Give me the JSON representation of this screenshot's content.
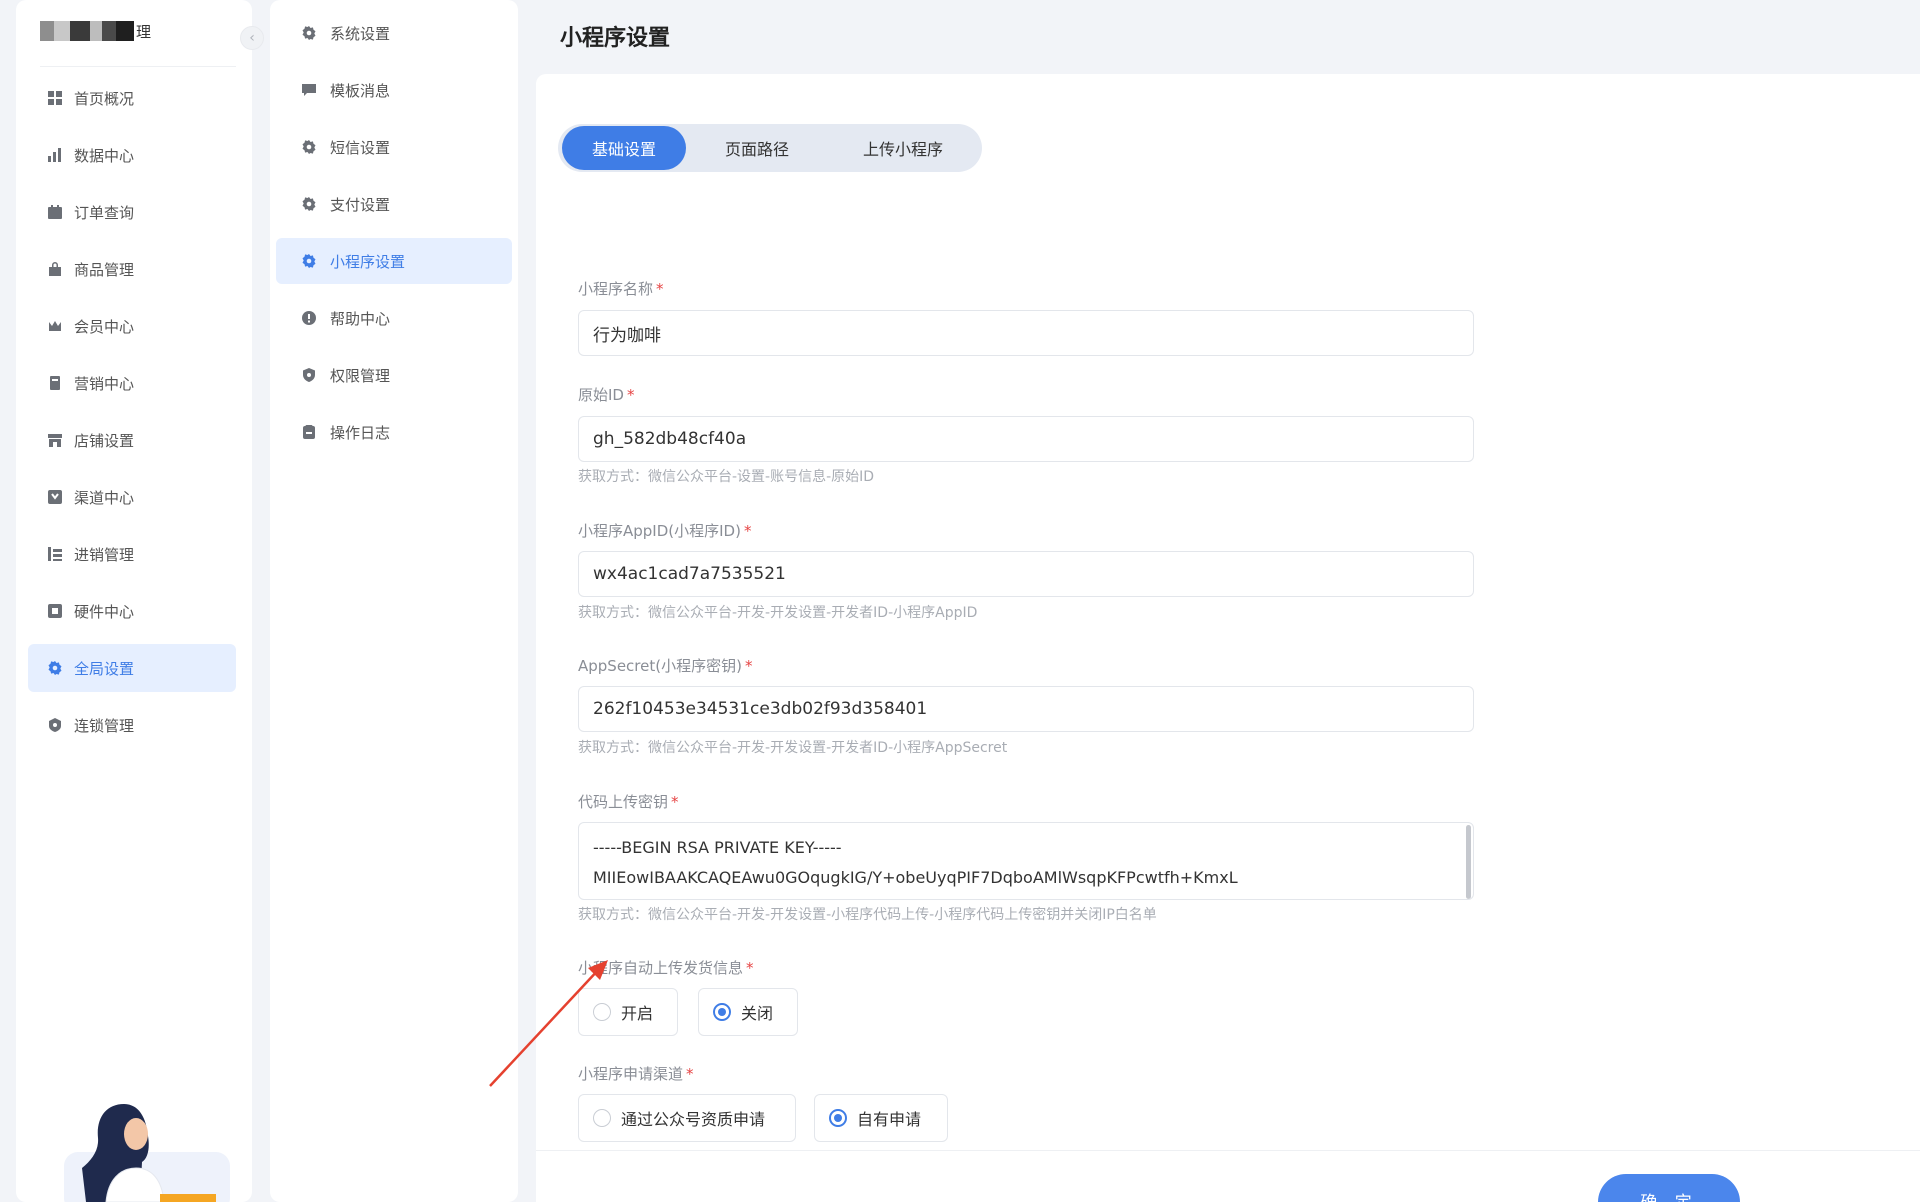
{
  "brand": {
    "text": "理",
    "colors": [
      "#8e8e8e",
      "#c8c8c8",
      "#3a3a3a",
      "#bdbdbd",
      "#4a4a4a",
      "#1f1f1f"
    ]
  },
  "sidebar": {
    "items": [
      {
        "label": "首页概况",
        "icon": "grid-icon",
        "active": false
      },
      {
        "label": "数据中心",
        "icon": "bar-chart-icon",
        "active": false
      },
      {
        "label": "订单查询",
        "icon": "calendar-icon",
        "active": false
      },
      {
        "label": "商品管理",
        "icon": "bag-icon",
        "active": false
      },
      {
        "label": "会员中心",
        "icon": "crown-icon",
        "active": false
      },
      {
        "label": "营销中心",
        "icon": "gift-icon",
        "active": false
      },
      {
        "label": "店铺设置",
        "icon": "store-icon",
        "active": false
      },
      {
        "label": "渠道中心",
        "icon": "channel-icon",
        "active": false
      },
      {
        "label": "进销管理",
        "icon": "inventory-icon",
        "active": false
      },
      {
        "label": "硬件中心",
        "icon": "hardware-icon",
        "active": false
      },
      {
        "label": "全局设置",
        "icon": "gear-icon",
        "active": true
      },
      {
        "label": "连锁管理",
        "icon": "chain-icon",
        "active": false
      }
    ]
  },
  "subnav": {
    "items": [
      {
        "label": "系统设置",
        "icon": "gear-icon",
        "active": false
      },
      {
        "label": "模板消息",
        "icon": "message-icon",
        "active": false
      },
      {
        "label": "短信设置",
        "icon": "gear-icon",
        "active": false
      },
      {
        "label": "支付设置",
        "icon": "gear-icon",
        "active": false
      },
      {
        "label": "小程序设置",
        "icon": "gear-icon",
        "active": true
      },
      {
        "label": "帮助中心",
        "icon": "help-icon",
        "active": false
      },
      {
        "label": "权限管理",
        "icon": "shield-icon",
        "active": false
      },
      {
        "label": "操作日志",
        "icon": "log-icon",
        "active": false
      }
    ]
  },
  "page": {
    "title": "小程序设置"
  },
  "tabs": [
    {
      "label": "基础设置",
      "active": true
    },
    {
      "label": "页面路径",
      "active": false
    },
    {
      "label": "上传小程序",
      "active": false
    }
  ],
  "form": {
    "required_mark": "*",
    "name": {
      "label": "小程序名称",
      "value": "行为咖啡"
    },
    "original_id": {
      "label": "原始ID",
      "value": "gh_582db48cf40a",
      "hint": "获取方式：微信公众平台-设置-账号信息-原始ID"
    },
    "app_id": {
      "label": "小程序AppID(小程序ID)",
      "value": "wx4ac1cad7a7535521",
      "hint": "获取方式：微信公众平台-开发-开发设置-开发者ID-小程序AppID"
    },
    "app_secret": {
      "label": "AppSecret(小程序密钥)",
      "value": "262f10453e34531ce3db02f93d358401",
      "hint": "获取方式：微信公众平台-开发-开发设置-开发者ID-小程序AppSecret"
    },
    "upload_key": {
      "label": "代码上传密钥",
      "line1": "-----BEGIN RSA PRIVATE KEY-----",
      "line2": "MIIEowIBAAKCAQEAwu0GOqugkIG/Y+obeUyqPIF7DqboAMlWsqpKFPcwtfh+KmxL",
      "hint": "获取方式：微信公众平台-开发-开发设置-小程序代码上传-小程序代码上传密钥并关闭IP白名单"
    },
    "auto_upload": {
      "label": "小程序自动上传发货信息",
      "option_on": "开启",
      "option_off": "关闭",
      "selected": "关闭"
    },
    "apply_channel": {
      "label": "小程序申请渠道",
      "option_a": "通过公众号资质申请",
      "option_b": "自有申请",
      "selected": "自有申请"
    }
  },
  "footer": {
    "confirm_label": "确 定"
  },
  "colors": {
    "accent": "#3f7de6",
    "required": "#e64545",
    "arrow": "#e5412f"
  }
}
